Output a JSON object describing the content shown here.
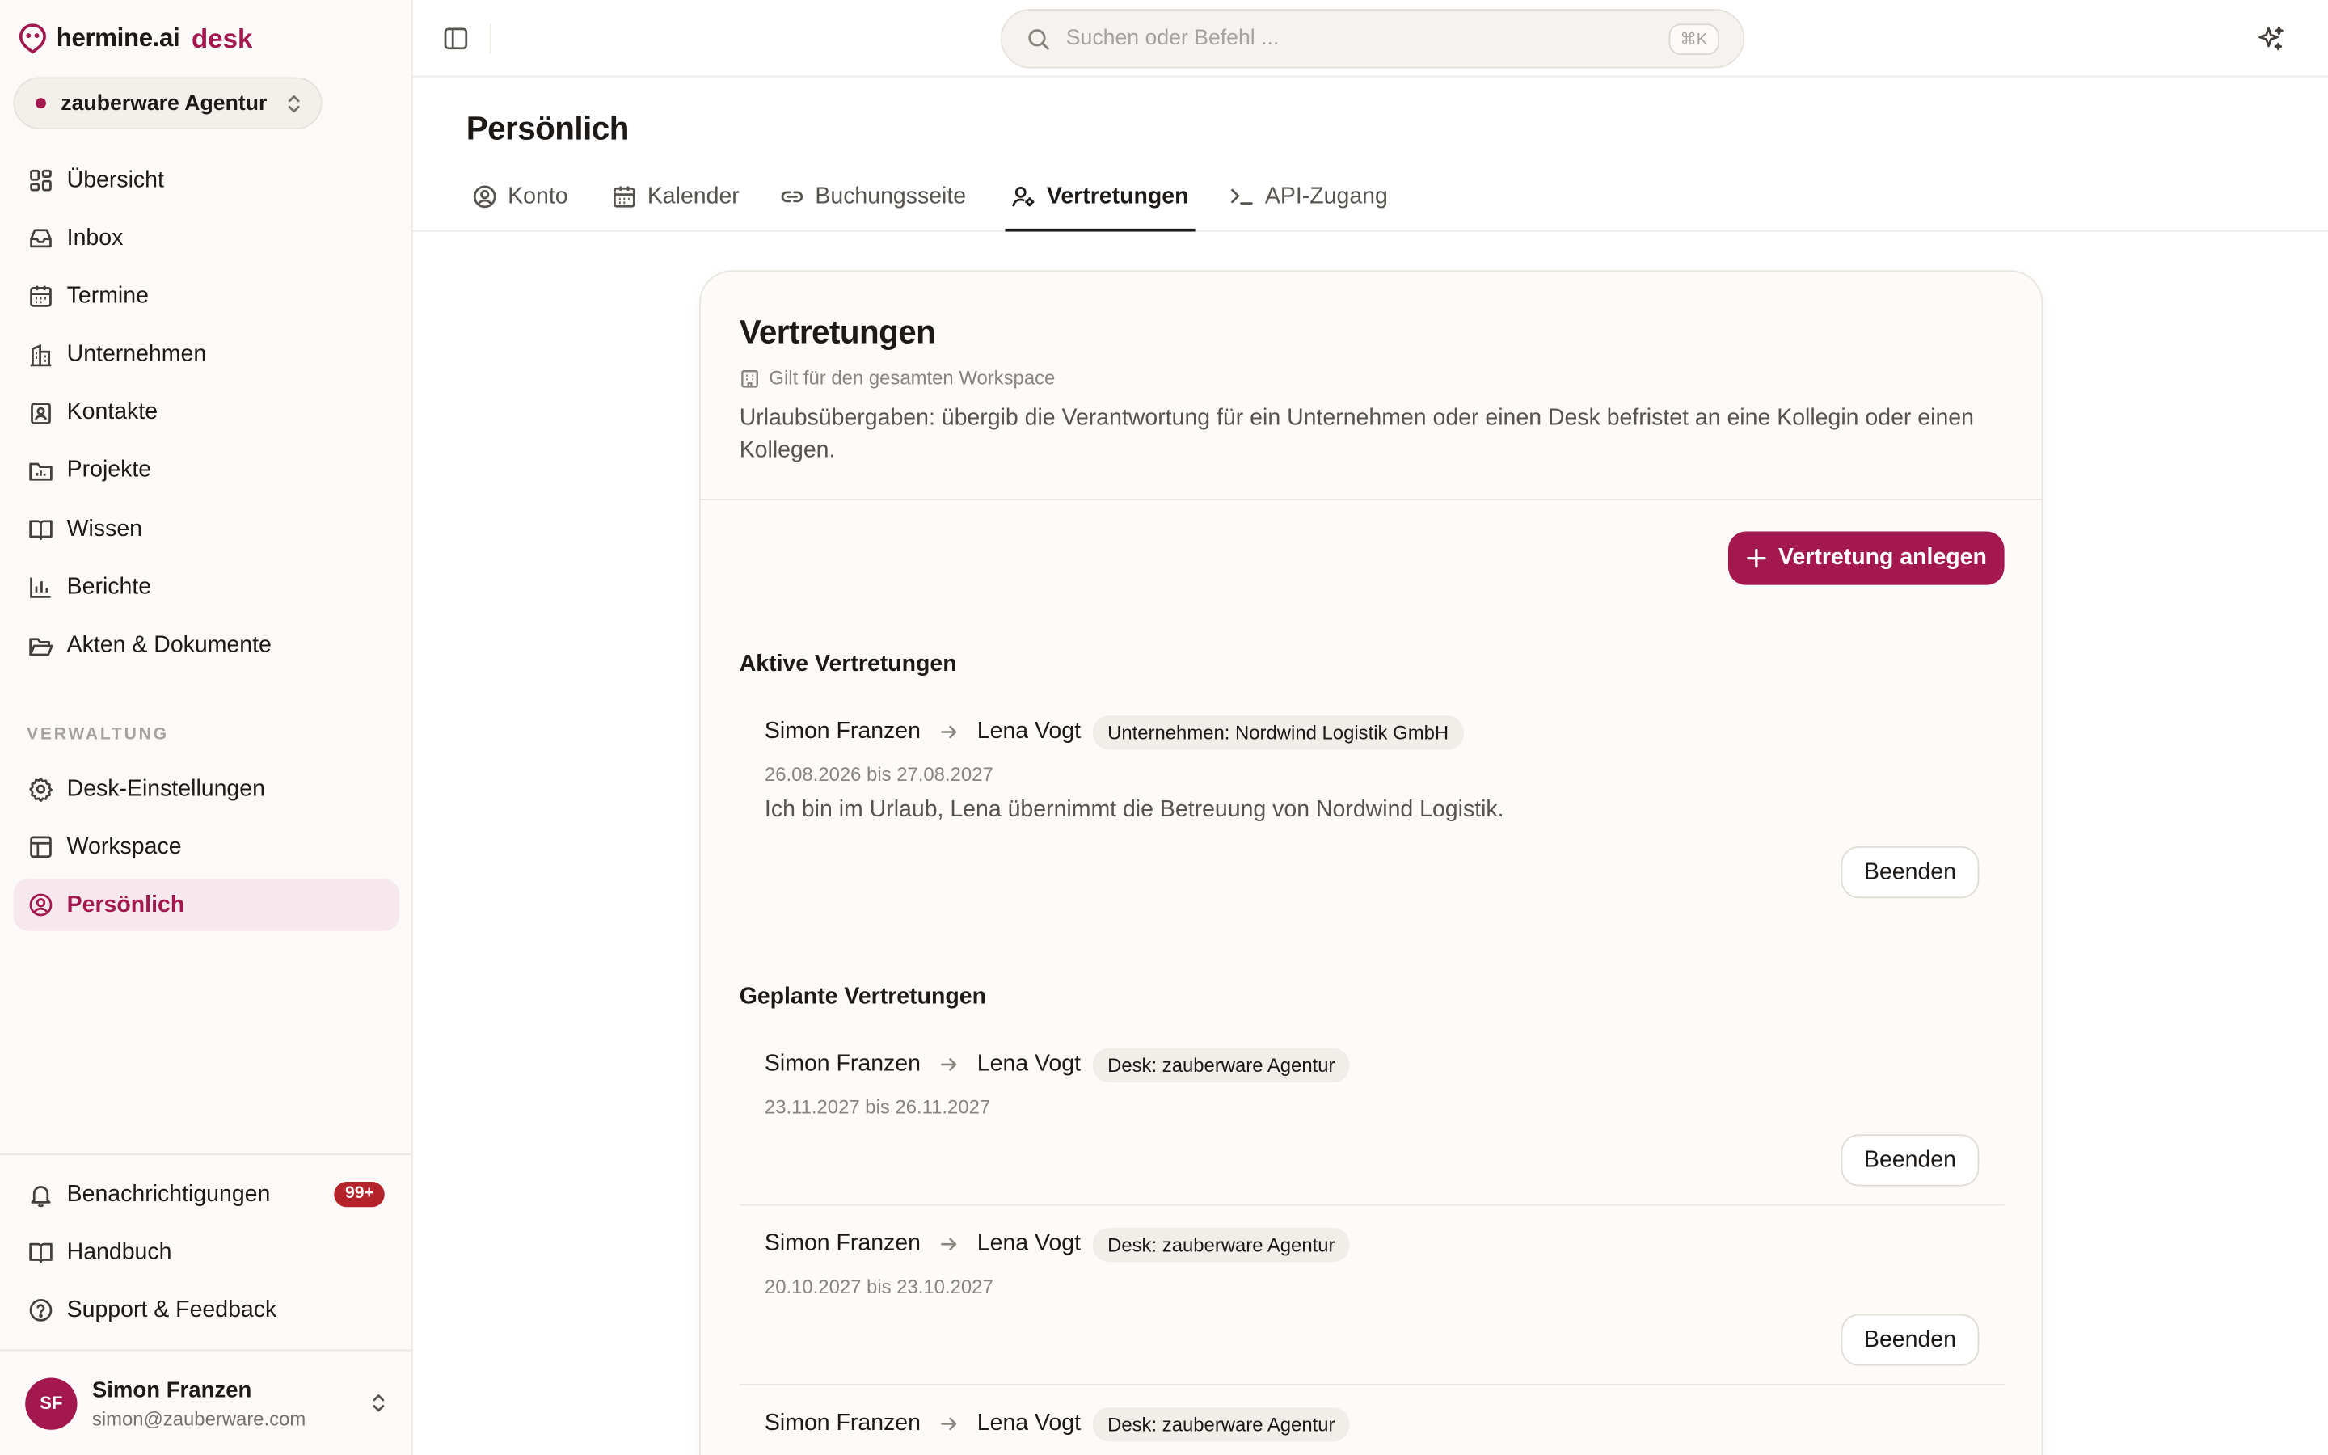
{
  "brand": {
    "name": "hermine.ai",
    "product": "desk",
    "accent": "#a3194f"
  },
  "workspace_switcher": {
    "label": "zauberware Agentur"
  },
  "sidebar": {
    "main_items": [
      {
        "label": "Übersicht",
        "icon": "dashboard-icon"
      },
      {
        "label": "Inbox",
        "icon": "inbox-icon"
      },
      {
        "label": "Termine",
        "icon": "calendar-icon"
      },
      {
        "label": "Unternehmen",
        "icon": "building-icon"
      },
      {
        "label": "Kontakte",
        "icon": "contact-icon"
      },
      {
        "label": "Projekte",
        "icon": "folder-chart-icon"
      },
      {
        "label": "Wissen",
        "icon": "book-icon"
      },
      {
        "label": "Berichte",
        "icon": "bar-chart-icon"
      },
      {
        "label": "Akten & Dokumente",
        "icon": "folder-open-icon"
      }
    ],
    "section_label": "VERWALTUNG",
    "admin_items": [
      {
        "label": "Desk-Einstellungen",
        "icon": "gear-icon"
      },
      {
        "label": "Workspace",
        "icon": "layout-icon"
      },
      {
        "label": "Persönlich",
        "icon": "user-circle-icon",
        "active": true
      }
    ],
    "bottom_items": [
      {
        "label": "Benachrichtigungen",
        "icon": "bell-icon",
        "badge": "99+"
      },
      {
        "label": "Handbuch",
        "icon": "book-icon"
      },
      {
        "label": "Support & Feedback",
        "icon": "help-circle-icon"
      }
    ],
    "user": {
      "initials": "SF",
      "name": "Simon Franzen",
      "email": "simon@zauberware.com"
    }
  },
  "topbar": {
    "search_placeholder": "Suchen oder Befehl ...",
    "search_shortcut": "⌘K"
  },
  "page": {
    "title": "Persönlich",
    "tabs": [
      {
        "label": "Konto",
        "icon": "user-circle-icon"
      },
      {
        "label": "Kalender",
        "icon": "calendar-icon"
      },
      {
        "label": "Buchungsseite",
        "icon": "link-icon"
      },
      {
        "label": "Vertretungen",
        "icon": "user-cog-icon",
        "active": true
      },
      {
        "label": "API-Zugang",
        "icon": "terminal-icon"
      }
    ]
  },
  "card": {
    "title": "Vertretungen",
    "scope": "Gilt für den gesamten Workspace",
    "description": "Urlaubsübergaben: übergib die Verantwortung für ein Unternehmen oder einen Desk befristet an eine Kollegin oder einen Kollegen.",
    "create_button": "Vertretung anlegen",
    "active_heading": "Aktive Vertretungen",
    "planned_heading": "Geplante Vertretungen",
    "end_button": "Beenden",
    "active": [
      {
        "from": "Simon Franzen",
        "to": "Lena Vogt",
        "scope": "Unternehmen: Nordwind Logistik GmbH",
        "dates": "26.08.2026 bis 27.08.2027",
        "note": "Ich bin im Urlaub, Lena übernimmt die Betreuung von Nordwind Logistik."
      }
    ],
    "planned": [
      {
        "from": "Simon Franzen",
        "to": "Lena Vogt",
        "scope": "Desk: zauberware Agentur",
        "dates": "23.11.2027 bis 26.11.2027"
      },
      {
        "from": "Simon Franzen",
        "to": "Lena Vogt",
        "scope": "Desk: zauberware Agentur",
        "dates": "20.10.2027 bis 23.10.2027"
      },
      {
        "from": "Simon Franzen",
        "to": "Lena Vogt",
        "scope": "Desk: zauberware Agentur",
        "dates": ""
      }
    ]
  }
}
